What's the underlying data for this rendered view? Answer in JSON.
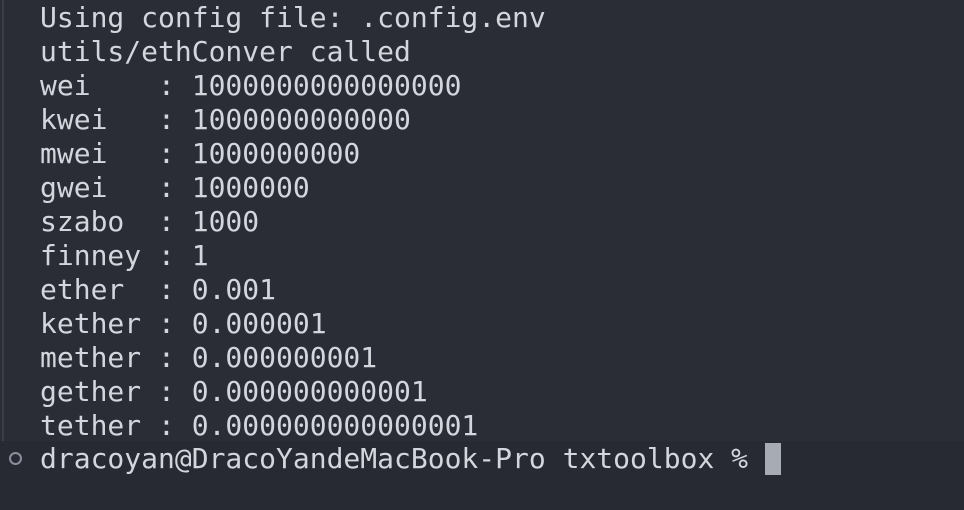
{
  "output": {
    "lines": [
      "Using config file: .config.env",
      "utils/ethConver called",
      "wei    : 1000000000000000",
      "kwei   : 1000000000000",
      "mwei   : 1000000000",
      "gwei   : 1000000",
      "szabo  : 1000",
      "finney : 1",
      "ether  : 0.001",
      "kether : 0.000001",
      "mether : 0.000000001",
      "gether : 0.000000000001",
      "tether : 0.000000000000001"
    ]
  },
  "prompt": {
    "text": "dracoyan@DracoYandeMacBook-Pro txtoolbox %"
  },
  "colors": {
    "background": "#272a33",
    "text": "#d3d6dc",
    "cursor": "#a7abb4"
  }
}
